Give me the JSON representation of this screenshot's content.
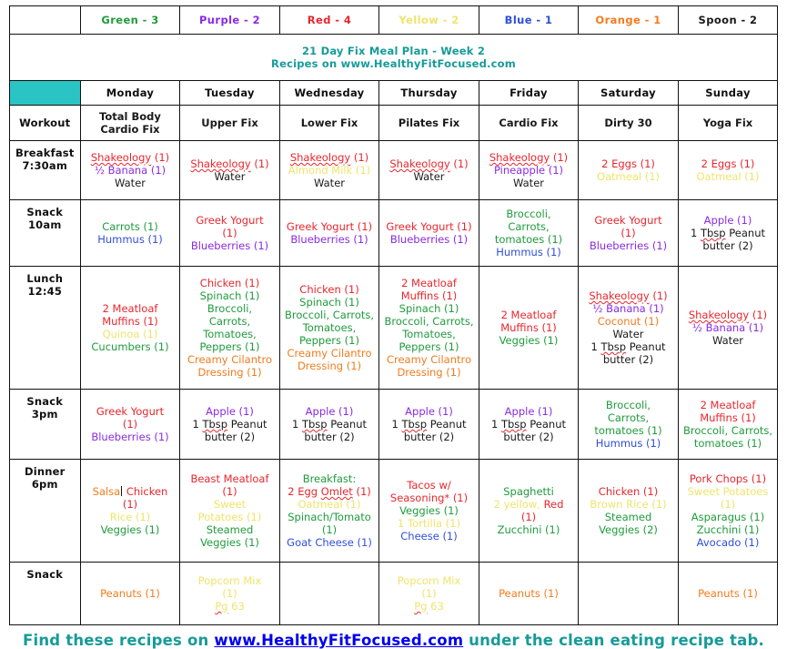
{
  "legend": {
    "blank_label": "",
    "items": [
      {
        "label": "Green - 3",
        "color": "#1f9b3c"
      },
      {
        "label": "Purple - 2",
        "color": "#8a2be2"
      },
      {
        "label": "Red - 4",
        "color": "#e8262d"
      },
      {
        "label": "Yellow - 2",
        "color": "#eee46b"
      },
      {
        "label": "Blue - 1",
        "color": "#2f4fd8"
      },
      {
        "label": "Orange - 1",
        "color": "#f07c1e"
      },
      {
        "label": "Spoon - 2",
        "color": "#1a1a1a"
      }
    ]
  },
  "title": {
    "line1": "21 Day Fix Meal Plan - Week 2",
    "line2": "Recipes on www.HealthyFitFocused.com"
  },
  "days": [
    "Monday",
    "Tuesday",
    "Wednesday",
    "Thursday",
    "Friday",
    "Saturday",
    "Sunday"
  ],
  "corner_label": "",
  "rows": [
    {
      "label": "Workout",
      "label_line2": "",
      "cells": [
        [
          {
            "t": "Total Body",
            "c": "black"
          },
          {
            "t": "Cardio Fix",
            "c": "black"
          }
        ],
        [
          {
            "t": "Upper Fix",
            "c": "black"
          }
        ],
        [
          {
            "t": "Lower Fix",
            "c": "black"
          }
        ],
        [
          {
            "t": "Pilates Fix",
            "c": "black"
          }
        ],
        [
          {
            "t": "Cardio Fix",
            "c": "black"
          }
        ],
        [
          {
            "t": "Dirty 30",
            "c": "black"
          }
        ],
        [
          {
            "t": "Yoga Fix",
            "c": "black"
          }
        ]
      ]
    },
    {
      "label": "Breakfast",
      "label_line2": "7:30am",
      "cells": [
        [
          {
            "t": "Shakeology (1)",
            "c": "red",
            "sq": "Shakeology"
          },
          {
            "t": "½ Banana (1)",
            "c": "purple"
          },
          {
            "t": "Water",
            "c": "black"
          }
        ],
        [
          {
            "t": "Shakeology (1)",
            "c": "red",
            "sq": "Shakeology"
          },
          {
            "t": "Water",
            "c": "black"
          }
        ],
        [
          {
            "t": "Shakeology (1)",
            "c": "red",
            "sq": "Shakeology"
          },
          {
            "t": "Almond Milk (1)",
            "c": "yellow"
          },
          {
            "t": "Water",
            "c": "black"
          }
        ],
        [
          {
            "t": "Shakeology (1)",
            "c": "red",
            "sq": "Shakeology"
          },
          {
            "t": "Water",
            "c": "black"
          }
        ],
        [
          {
            "t": "Shakeology (1)",
            "c": "red",
            "sq": "Shakeology"
          },
          {
            "t": "Pineapple (1)",
            "c": "purple"
          },
          {
            "t": "Water",
            "c": "black"
          }
        ],
        [
          {
            "t": "2 Eggs (1)",
            "c": "red"
          },
          {
            "t": "Oatmeal (1)",
            "c": "yellow"
          }
        ],
        [
          {
            "t": "2 Eggs (1)",
            "c": "red"
          },
          {
            "t": "Oatmeal (1)",
            "c": "yellow"
          }
        ]
      ]
    },
    {
      "label": "Snack",
      "label_line2": "10am",
      "cells": [
        [
          {
            "t": "Carrots (1)",
            "c": "green"
          },
          {
            "t": "Hummus (1)",
            "c": "blue"
          }
        ],
        [
          {
            "t": "Greek Yogurt",
            "c": "red"
          },
          {
            "t": "(1)",
            "c": "red"
          },
          {
            "t": "Blueberries (1)",
            "c": "purple"
          }
        ],
        [
          {
            "t": "Greek Yogurt (1)",
            "c": "red"
          },
          {
            "t": "Blueberries (1)",
            "c": "purple"
          }
        ],
        [
          {
            "t": "Greek Yogurt (1)",
            "c": "red"
          },
          {
            "t": "Blueberries (1)",
            "c": "purple"
          }
        ],
        [
          {
            "t": "Broccoli,",
            "c": "green"
          },
          {
            "t": "Carrots,",
            "c": "green"
          },
          {
            "t": "tomatoes (1)",
            "c": "green"
          },
          {
            "t": "Hummus (1)",
            "c": "blue"
          }
        ],
        [
          {
            "t": "Greek Yogurt",
            "c": "red"
          },
          {
            "t": "(1)",
            "c": "red"
          },
          {
            "t": "Blueberries (1)",
            "c": "purple"
          }
        ],
        [
          {
            "t": "Apple (1)",
            "c": "purple"
          },
          {
            "t": "1 Tbsp Peanut",
            "c": "black",
            "sq": "Tbsp"
          },
          {
            "t": "butter (2)",
            "c": "black"
          }
        ]
      ]
    },
    {
      "label": "Lunch",
      "label_line2": "12:45",
      "cells": [
        [
          {
            "t": "2 Meatloaf",
            "c": "red"
          },
          {
            "t": "Muffins (1)",
            "c": "red"
          },
          {
            "t": "Quinoa (1)",
            "c": "yellow"
          },
          {
            "t": "Cucumbers (1)",
            "c": "green"
          }
        ],
        [
          {
            "t": "Chicken (1)",
            "c": "red"
          },
          {
            "t": "Spinach (1)",
            "c": "green"
          },
          {
            "t": "Broccoli,",
            "c": "green"
          },
          {
            "t": "Carrots,",
            "c": "green"
          },
          {
            "t": "Tomatoes,",
            "c": "green"
          },
          {
            "t": "Peppers (1)",
            "c": "green"
          },
          {
            "t": "Creamy Cilantro",
            "c": "orange"
          },
          {
            "t": "Dressing (1)",
            "c": "orange"
          }
        ],
        [
          {
            "t": "Chicken (1)",
            "c": "red"
          },
          {
            "t": "Spinach (1)",
            "c": "green"
          },
          {
            "t": "Broccoli, Carrots,",
            "c": "green"
          },
          {
            "t": "Tomatoes,",
            "c": "green"
          },
          {
            "t": "Peppers (1)",
            "c": "green"
          },
          {
            "t": "Creamy Cilantro",
            "c": "orange"
          },
          {
            "t": "Dressing (1)",
            "c": "orange"
          }
        ],
        [
          {
            "t": "2 Meatloaf",
            "c": "red"
          },
          {
            "t": "Muffins (1)",
            "c": "red"
          },
          {
            "t": "Spinach (1)",
            "c": "green"
          },
          {
            "t": "Broccoli, Carrots,",
            "c": "green"
          },
          {
            "t": "Tomatoes,",
            "c": "green"
          },
          {
            "t": "Peppers (1)",
            "c": "green"
          },
          {
            "t": "Creamy Cilantro",
            "c": "orange"
          },
          {
            "t": "Dressing (1)",
            "c": "orange"
          }
        ],
        [
          {
            "t": "2 Meatloaf",
            "c": "red"
          },
          {
            "t": "Muffins (1)",
            "c": "red"
          },
          {
            "t": "Veggies (1)",
            "c": "green"
          }
        ],
        [
          {
            "t": "Shakeology (1)",
            "c": "red",
            "sq": "Shakeology"
          },
          {
            "t": "½ Banana (1)",
            "c": "purple"
          },
          {
            "t": "Coconut (1)",
            "c": "orange"
          },
          {
            "t": "Water",
            "c": "black"
          },
          {
            "t": "1 Tbsp Peanut",
            "c": "black",
            "sq": "Tbsp"
          },
          {
            "t": "butter (2)",
            "c": "black"
          }
        ],
        [
          {
            "t": "Shakeology (1)",
            "c": "red",
            "sq": "Shakeology"
          },
          {
            "t": "½ Banana (1)",
            "c": "purple"
          },
          {
            "t": "Water",
            "c": "black"
          }
        ]
      ]
    },
    {
      "label": "Snack",
      "label_line2": "3pm",
      "cells": [
        [
          {
            "t": "Greek Yogurt",
            "c": "red"
          },
          {
            "t": "(1)",
            "c": "red"
          },
          {
            "t": "Blueberries (1)",
            "c": "purple"
          }
        ],
        [
          {
            "t": "Apple (1)",
            "c": "purple"
          },
          {
            "t": "1 Tbsp Peanut",
            "c": "black",
            "sq": "Tbsp"
          },
          {
            "t": "butter (2)",
            "c": "black"
          }
        ],
        [
          {
            "t": "Apple (1)",
            "c": "purple"
          },
          {
            "t": "1 Tbsp Peanut",
            "c": "black",
            "sq": "Tbsp"
          },
          {
            "t": "butter (2)",
            "c": "black"
          }
        ],
        [
          {
            "t": "Apple (1)",
            "c": "purple"
          },
          {
            "t": "1 Tbsp Peanut",
            "c": "black",
            "sq": "Tbsp"
          },
          {
            "t": "butter (2)",
            "c": "black"
          }
        ],
        [
          {
            "t": "Apple (1)",
            "c": "purple"
          },
          {
            "t": "1 Tbsp Peanut",
            "c": "black",
            "sq": "Tbsp"
          },
          {
            "t": "butter (2)",
            "c": "black"
          }
        ],
        [
          {
            "t": "Broccoli,",
            "c": "green"
          },
          {
            "t": "Carrots,",
            "c": "green"
          },
          {
            "t": "tomatoes (1)",
            "c": "green"
          },
          {
            "t": "Hummus (1)",
            "c": "blue"
          }
        ],
        [
          {
            "t": "2 Meatloaf",
            "c": "red"
          },
          {
            "t": "Muffins (1)",
            "c": "red"
          },
          {
            "t": "Broccoli, Carrots,",
            "c": "green"
          },
          {
            "t": "tomatoes (1)",
            "c": "green"
          }
        ]
      ]
    },
    {
      "label": "Dinner",
      "label_line2": "6pm",
      "cells": [
        [
          {
            "t": "Salsa Chicken",
            "c": "mixed_salsa"
          },
          {
            "t": "(1)",
            "c": "red"
          },
          {
            "t": "Rice (1)",
            "c": "yellow"
          },
          {
            "t": "Veggies (1)",
            "c": "green"
          }
        ],
        [
          {
            "t": "Beast Meatloaf",
            "c": "red"
          },
          {
            "t": "(1)",
            "c": "red"
          },
          {
            "t": "Sweet",
            "c": "yellow"
          },
          {
            "t": "Potatoes (1)",
            "c": "yellow"
          },
          {
            "t": "Steamed",
            "c": "green"
          },
          {
            "t": "Veggies (1)",
            "c": "green"
          }
        ],
        [
          {
            "t": "Breakfast:",
            "c": "green"
          },
          {
            "t": "2 Egg Omlet (1)",
            "c": "red",
            "sq": "Omlet"
          },
          {
            "t": "Oatmeal (1)",
            "c": "yellow"
          },
          {
            "t": "Spinach/Tomato",
            "c": "green"
          },
          {
            "t": "(1)",
            "c": "green"
          },
          {
            "t": "Goat Cheese (1)",
            "c": "blue"
          }
        ],
        [
          {
            "t": "Tacos w/",
            "c": "red"
          },
          {
            "t": "Seasoning* (1)",
            "c": "red"
          },
          {
            "t": "Veggies (1)",
            "c": "green"
          },
          {
            "t": "1 Tortilla (1)",
            "c": "yellow"
          },
          {
            "t": "Cheese (1)",
            "c": "blue"
          }
        ],
        [
          {
            "t": "Spaghetti",
            "c": "green"
          },
          {
            "t": "2 yellow, Red",
            "c": "mixed_spaghetti"
          },
          {
            "t": "(1)",
            "c": "red"
          },
          {
            "t": "Zucchini (1)",
            "c": "green"
          }
        ],
        [
          {
            "t": "Chicken (1)",
            "c": "red"
          },
          {
            "t": "Brown Rice (1)",
            "c": "yellow"
          },
          {
            "t": "Steamed",
            "c": "green"
          },
          {
            "t": "Veggies (2)",
            "c": "green"
          }
        ],
        [
          {
            "t": "Pork Chops (1)",
            "c": "red"
          },
          {
            "t": "Sweet Potatoes",
            "c": "yellow"
          },
          {
            "t": "(1)",
            "c": "yellow"
          },
          {
            "t": "Asparagus (1)",
            "c": "green"
          },
          {
            "t": "Zucchini (1)",
            "c": "green"
          },
          {
            "t": "Avocado (1)",
            "c": "blue"
          }
        ]
      ]
    },
    {
      "label": "Snack",
      "label_line2": "",
      "cells": [
        [
          {
            "t": "Peanuts (1)",
            "c": "orange"
          }
        ],
        [
          {
            "t": "Popcorn Mix",
            "c": "yellow"
          },
          {
            "t": "(1)",
            "c": "yellow"
          },
          {
            "t": "Pg 63",
            "c": "yellow",
            "sq": "Pg"
          }
        ],
        [],
        [
          {
            "t": "Popcorn Mix",
            "c": "yellow"
          },
          {
            "t": "(1)",
            "c": "yellow"
          },
          {
            "t": "Pg 63",
            "c": "yellow",
            "sq": "Pg"
          }
        ],
        [
          {
            "t": "Peanuts (1)",
            "c": "orange"
          }
        ],
        [],
        [
          {
            "t": "Peanuts (1)",
            "c": "orange"
          }
        ]
      ]
    }
  ],
  "footer": {
    "before": "Find these recipes on ",
    "link": "www.HealthyFitFocused.com",
    "after": " under the clean eating recipe tab."
  }
}
